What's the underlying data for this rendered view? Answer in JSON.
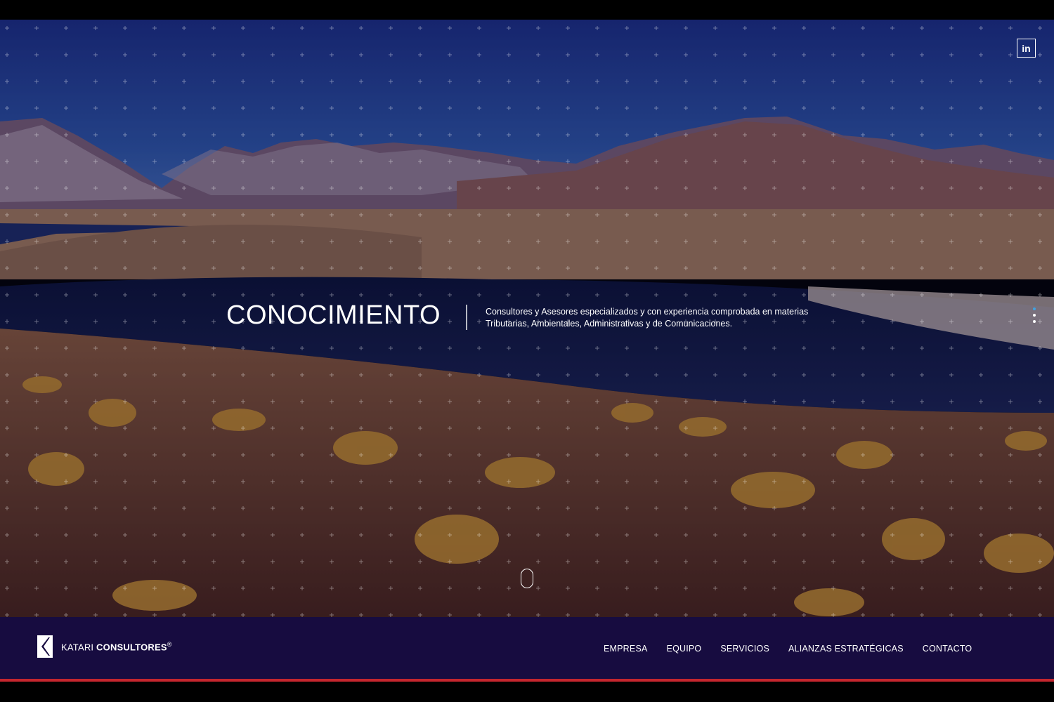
{
  "hero": {
    "headline": "CONOCIMIENTO",
    "tagline_line1": "Consultores y Asesores especializados y con experiencia comprobada en materias",
    "tagline_line2": "Tributarias, Ambientales, Administrativas y de Comunicaciones.",
    "slide_count": 3,
    "active_slide": 1
  },
  "social": {
    "linkedin_label": "in",
    "linkedin_icon": "linkedin-icon"
  },
  "brand": {
    "name_light": "KATARI",
    "name_bold": "CONSULTORES",
    "registered": "®",
    "logo_icon": "katari-logo-icon"
  },
  "nav": {
    "items": [
      {
        "label": "EMPRESA"
      },
      {
        "label": "EQUIPO"
      },
      {
        "label": "SERVICIOS"
      },
      {
        "label": "ALIANZAS ESTRATÉGICAS"
      },
      {
        "label": "CONTACTO"
      }
    ]
  },
  "colors": {
    "navbar": "#170c40",
    "accent_line": "#c4262e",
    "active_dot": "#3fa3e0"
  }
}
